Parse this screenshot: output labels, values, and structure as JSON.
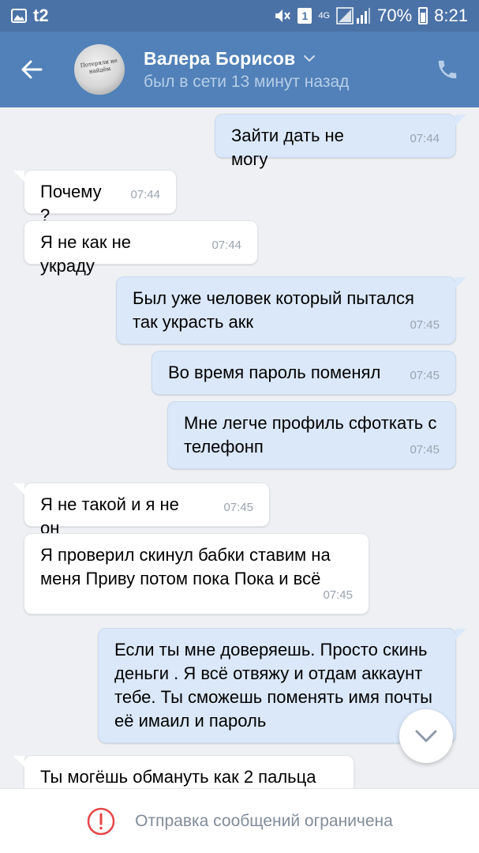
{
  "status_bar": {
    "carrier": "t2",
    "network": "4G",
    "sim": "1",
    "battery": "70%",
    "time": "8:21"
  },
  "header": {
    "contact_name": "Валера Борисов",
    "last_seen": "был в сети 13 минут назад",
    "avatar_text": "Потеряли не найдём"
  },
  "messages": [
    {
      "dir": "out",
      "text": "Зайти дать не могу",
      "time": "07:44"
    },
    {
      "dir": "in",
      "text": "Почему ?",
      "time": "07:44"
    },
    {
      "dir": "in",
      "text": "Я не как не украду",
      "time": "07:44"
    },
    {
      "dir": "out",
      "text": "Был уже человек который пытался так украсть акк",
      "time": "07:45"
    },
    {
      "dir": "out",
      "text": "Во время пароль поменял",
      "time": "07:45"
    },
    {
      "dir": "out",
      "text": "Мне легче профиль сфоткать с телефонп",
      "time": "07:45"
    },
    {
      "dir": "in",
      "text": "Я не такой и я не он",
      "time": "07:45"
    },
    {
      "dir": "in",
      "text": "Я проверил скинул бабки ставим на меня Приву потом пока Пока и всё",
      "time": "07:45"
    },
    {
      "dir": "out",
      "text": "Если ты мне доверяешь. Просто скинь деньги . Я всё отвяжу и отдам аккаунт тебе.  Ты сможешь поменять имя почты её имаил  и пароль",
      "time": ""
    },
    {
      "dir": "in",
      "text": "Ты могёшь обмануть как 2 пальца",
      "time": ""
    }
  ],
  "footer": {
    "restricted_text": "Отправка сообщений ограничена"
  },
  "colors": {
    "header_bg": "#5181b8",
    "status_bg": "#4b72a6",
    "chat_bg": "#eef0f3",
    "incoming_bubble": "#ffffff",
    "outgoing_bubble": "#dbe8f9",
    "alert_red": "#e64646"
  },
  "icons": {
    "back": "arrow-left-icon",
    "call": "phone-icon",
    "expand": "chevron-down-icon",
    "scroll_down": "chevron-down-icon",
    "alert": "alert-circle-icon"
  }
}
